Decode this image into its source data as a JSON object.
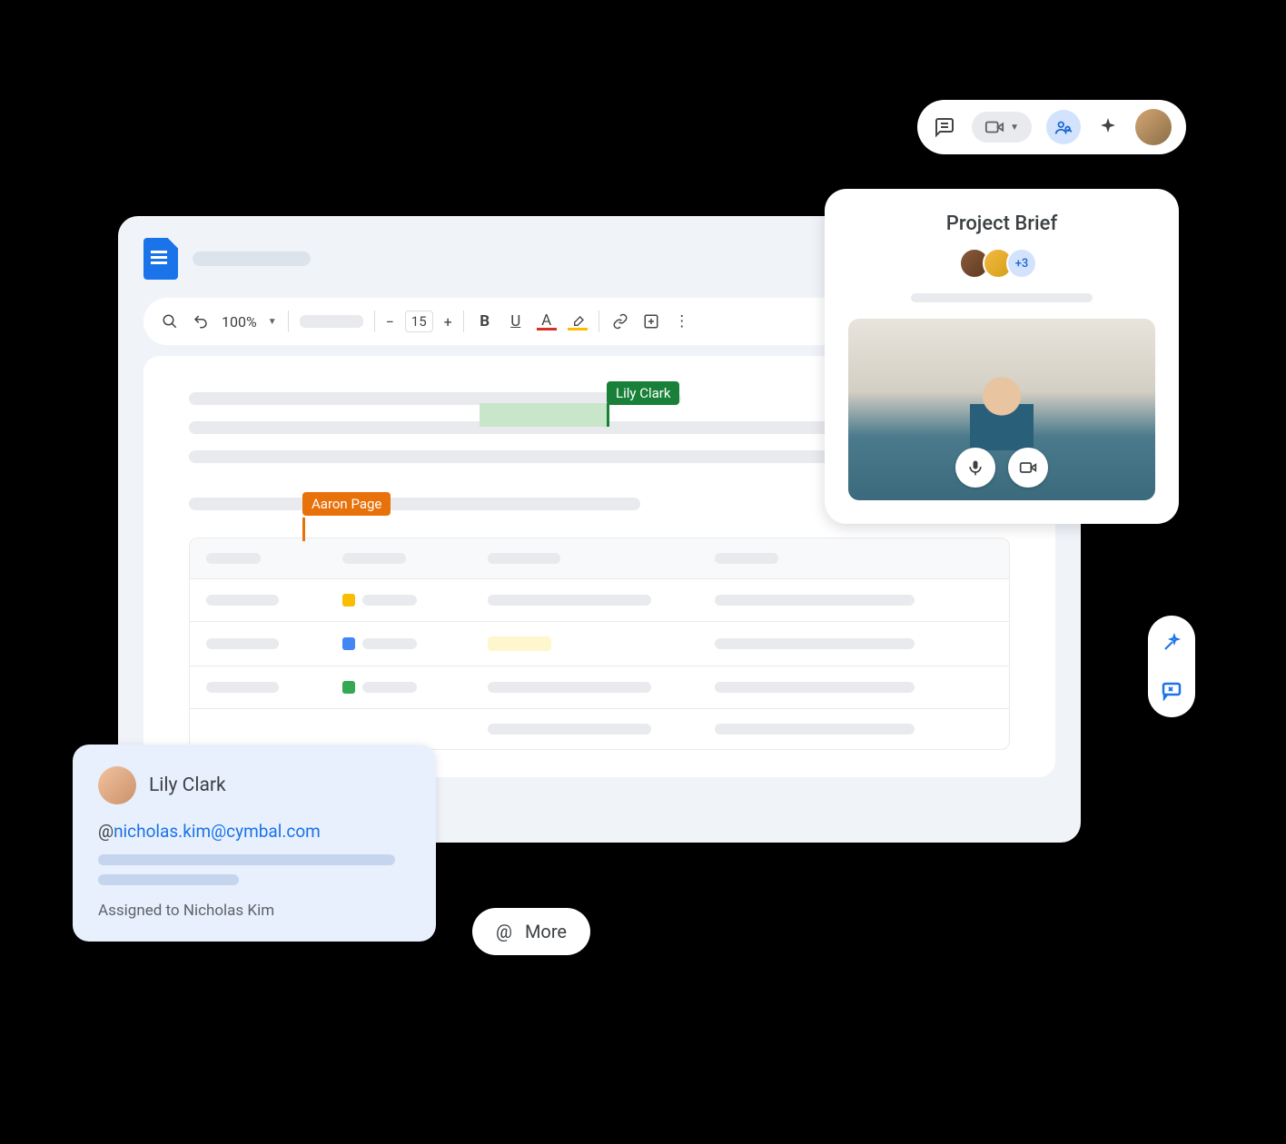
{
  "topToolbar": {
    "icons": {
      "comment": "comment-icon",
      "video": "video-icon",
      "share": "share-icon",
      "sparkle": "sparkle-icon"
    }
  },
  "doc": {
    "zoom": "100%",
    "fontSize": "15",
    "collaborators": {
      "green": "Lily Clark",
      "orange": "Aaron Page"
    }
  },
  "meet": {
    "title": "Project Brief",
    "moreCount": "+3"
  },
  "comment": {
    "author": "Lily Clark",
    "mentionPrefix": "@",
    "mention": "nicholas.kim@cymbal.com",
    "assigned": "Assigned to Nicholas Kim"
  },
  "more": {
    "label": "More"
  }
}
